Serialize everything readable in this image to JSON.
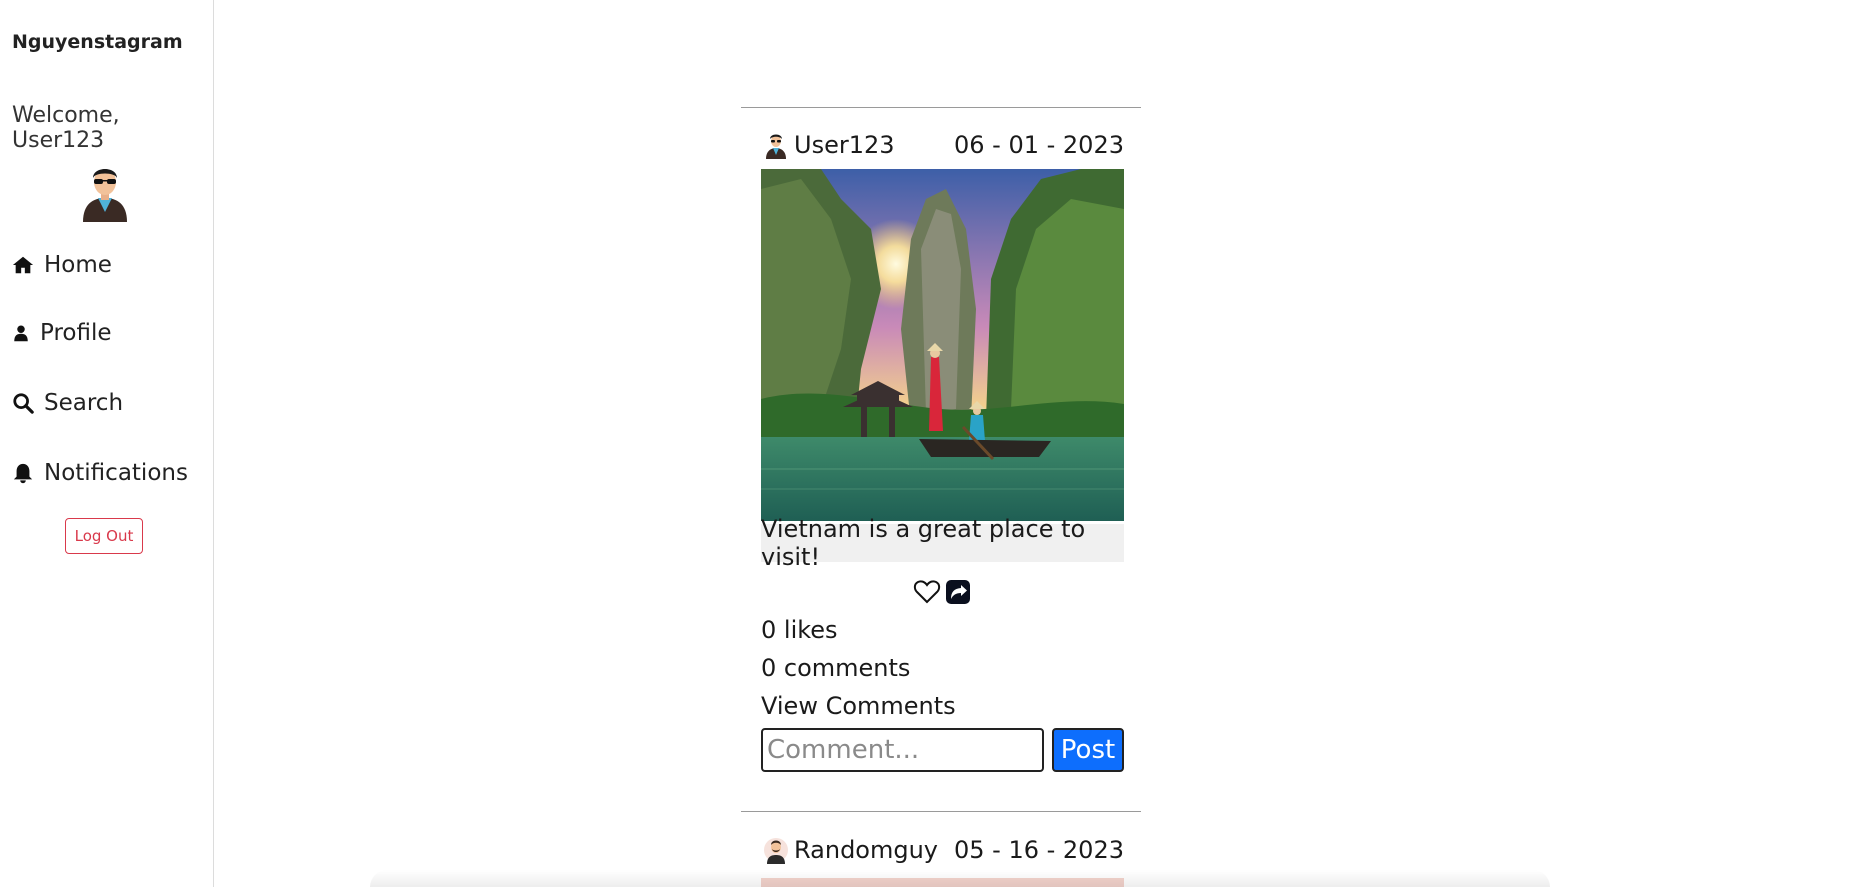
{
  "sidebar": {
    "brand": "Nguyenstagram",
    "welcome": "Welcome, User123",
    "nav": [
      {
        "label": "Home",
        "icon": "home-icon"
      },
      {
        "label": "Profile",
        "icon": "user-icon"
      },
      {
        "label": "Search",
        "icon": "search-icon"
      },
      {
        "label": "Notifications",
        "icon": "bell-icon"
      }
    ],
    "logout_label": "Log Out"
  },
  "posts": [
    {
      "username": "User123",
      "date": "06 - 01 - 2023",
      "caption": "Vietnam is a great place to visit!",
      "likes": "0 likes",
      "comments": "0 comments",
      "view_comments": "View Comments",
      "comment_placeholder": "Comment...",
      "post_label": "Post"
    },
    {
      "username": "Randomguy",
      "date": "05 - 16 - 2023"
    }
  ],
  "colors": {
    "accent": "#0d6efd",
    "logout": "#d9394b",
    "caption_bg": "#f0f0f0"
  }
}
